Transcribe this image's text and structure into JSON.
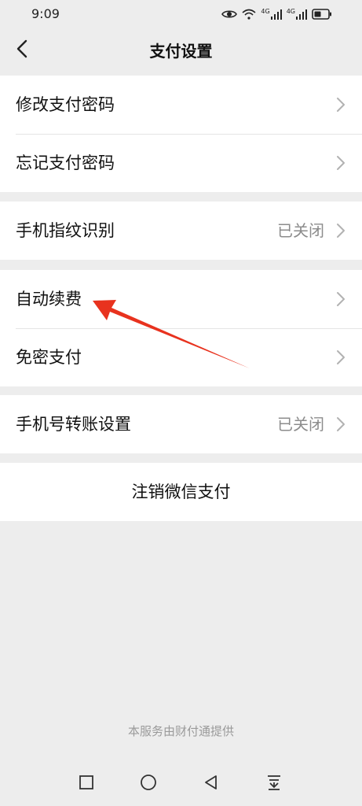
{
  "status_bar": {
    "time": "9:09",
    "icons": [
      "eye-icon",
      "wifi-icon",
      "signal-4g-icon",
      "signal-4g-icon",
      "battery-icon"
    ],
    "signal_label_1": "4G",
    "signal_label_2": "4G"
  },
  "header": {
    "title": "支付设置",
    "back_icon": "chevron-left-icon"
  },
  "groups": [
    {
      "items": [
        {
          "label": "修改支付密码",
          "value": ""
        },
        {
          "label": "忘记支付密码",
          "value": ""
        }
      ]
    },
    {
      "items": [
        {
          "label": "手机指纹识别",
          "value": "已关闭"
        }
      ]
    },
    {
      "items": [
        {
          "label": "自动续费",
          "value": ""
        },
        {
          "label": "免密支付",
          "value": ""
        }
      ]
    },
    {
      "items": [
        {
          "label": "手机号转账设置",
          "value": "已关闭"
        }
      ]
    }
  ],
  "deregister": {
    "label": "注销微信支付"
  },
  "footer": {
    "note": "本服务由财付通提供"
  },
  "system_nav": {
    "icons": [
      "recent-apps-icon",
      "home-icon",
      "back-icon",
      "notification-drawer-icon"
    ]
  },
  "colors": {
    "background": "#ededed",
    "card": "#ffffff",
    "secondary_text": "#8c8c8c",
    "annotation_red": "#e8321e"
  }
}
